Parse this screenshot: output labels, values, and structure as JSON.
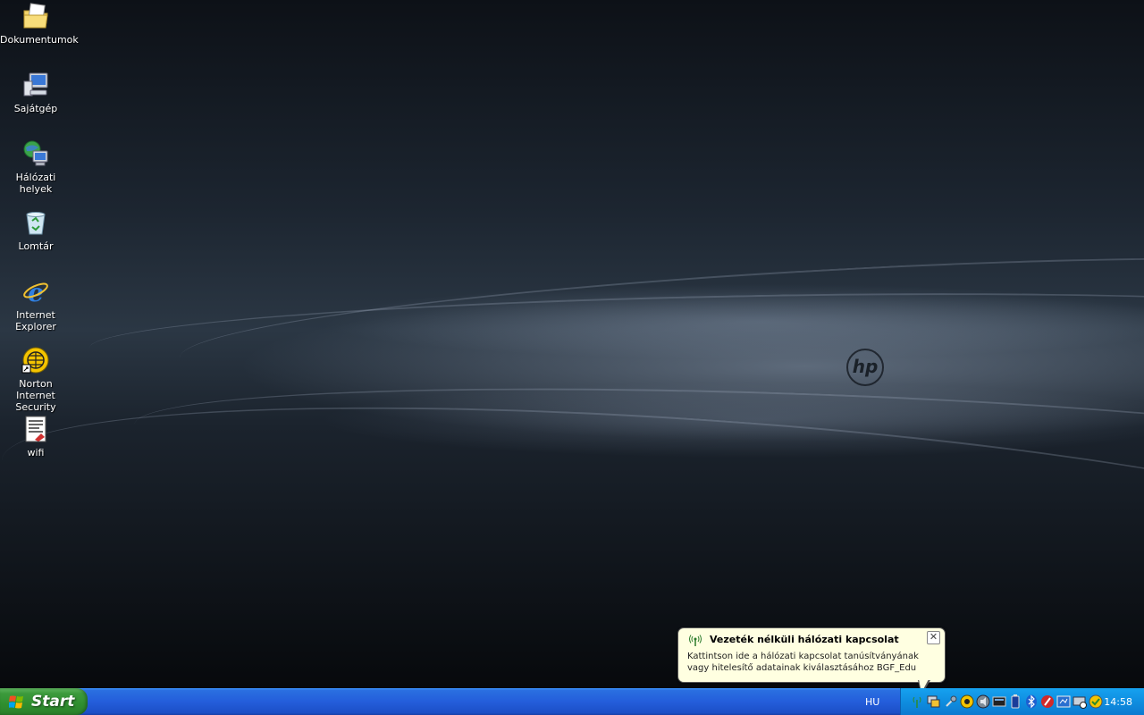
{
  "desktop": {
    "wallpaper_brand": "hp",
    "icons": [
      {
        "label": "Dokumentumok",
        "icon": "my-documents-icon"
      },
      {
        "label": "Sajátgép",
        "icon": "my-computer-icon"
      },
      {
        "label": "Hálózati helyek",
        "icon": "network-places-icon"
      },
      {
        "label": "Lomtár",
        "icon": "recycle-bin-icon"
      },
      {
        "label": "Internet Explorer",
        "icon": "internet-explorer-icon"
      },
      {
        "label": "Norton Internet Security",
        "icon": "norton-icon"
      },
      {
        "label": "wifi",
        "icon": "document-icon"
      }
    ]
  },
  "balloon": {
    "title": "Vezeték nélküli hálózati kapcsolat",
    "message": "Kattintson ide a hálózati kapcsolat tanúsítványának vagy hitelesítő adatainak kiválasztásához BGF_Edu",
    "close": "✕"
  },
  "taskbar": {
    "start_label": "Start",
    "language": "HU",
    "clock": "14:58",
    "tray_icons": [
      "wireless-network-icon",
      "network-connection-icon",
      "satellite-icon",
      "norton-shield-icon",
      "sound-icon",
      "display-icon",
      "battery-icon",
      "bluetooth-icon",
      "antivirus-icon",
      "monitor-icon",
      "safely-remove-icon",
      "security-center-icon"
    ]
  },
  "colors": {
    "taskbar": "#245edb",
    "start_button": "#3c9a3c",
    "tray": "#0f8ee0",
    "balloon_bg": "#ffffe1"
  }
}
